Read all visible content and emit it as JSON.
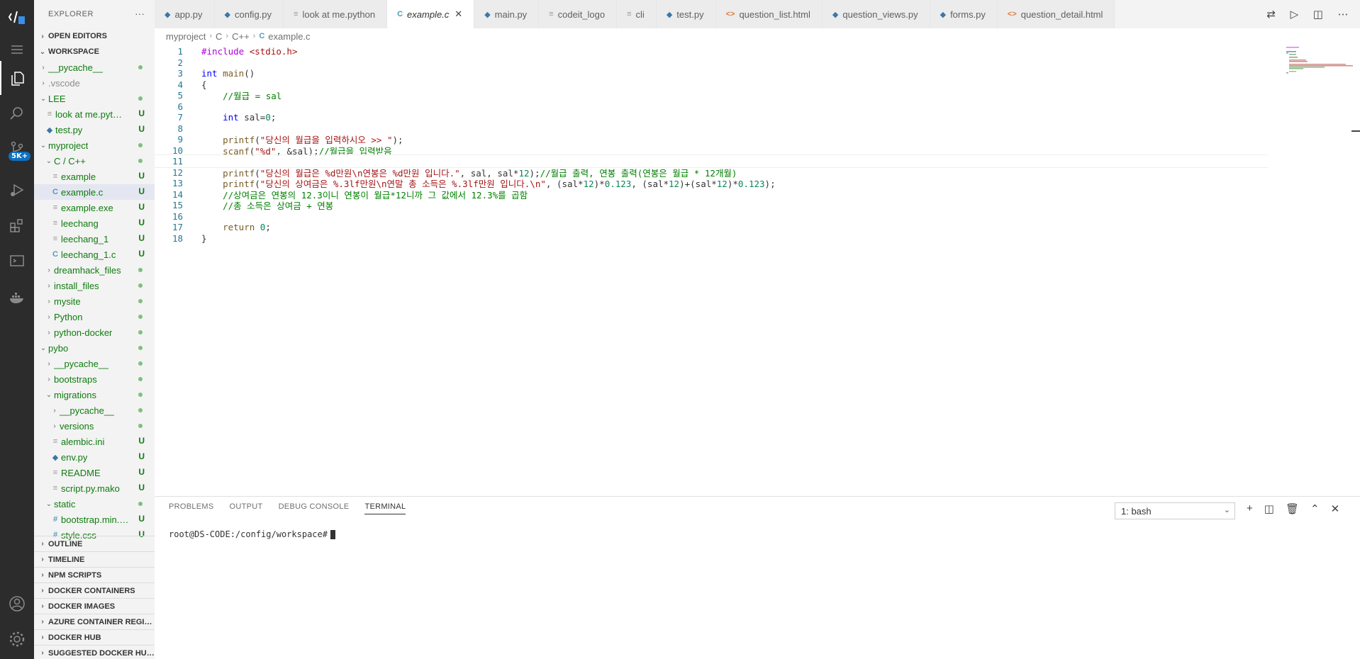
{
  "explorer": {
    "title": "EXPLORER",
    "more": "···",
    "open_editors": "OPEN EDITORS",
    "workspace": "WORKSPACE",
    "tree": [
      {
        "name": "__pycache__",
        "kind": "folder",
        "depth": 1,
        "open": false,
        "status": "dot"
      },
      {
        "name": ".vscode",
        "kind": "folder",
        "depth": 1,
        "open": false,
        "status": "",
        "muted": true
      },
      {
        "name": "LEE",
        "kind": "folder",
        "depth": 1,
        "open": true,
        "status": "dot"
      },
      {
        "name": "look at me.python",
        "kind": "lines",
        "depth": 2,
        "status": "U"
      },
      {
        "name": "test.py",
        "kind": "py",
        "depth": 2,
        "status": "U"
      },
      {
        "name": "myproject",
        "kind": "folder",
        "depth": 1,
        "open": true,
        "status": "dot"
      },
      {
        "name": "C / C++",
        "kind": "folder",
        "depth": 2,
        "open": true,
        "status": "dot"
      },
      {
        "name": "example",
        "kind": "lines",
        "depth": 3,
        "status": "U"
      },
      {
        "name": "example.c",
        "kind": "c",
        "depth": 3,
        "status": "U",
        "selected": true
      },
      {
        "name": "example.exe",
        "kind": "lines",
        "depth": 3,
        "status": "U"
      },
      {
        "name": "leechang",
        "kind": "lines",
        "depth": 3,
        "status": "U"
      },
      {
        "name": "leechang_1",
        "kind": "lines",
        "depth": 3,
        "status": "U"
      },
      {
        "name": "leechang_1.c",
        "kind": "c",
        "depth": 3,
        "status": "U"
      },
      {
        "name": "dreamhack_files",
        "kind": "folder",
        "depth": 2,
        "open": false,
        "status": "dot"
      },
      {
        "name": "install_files",
        "kind": "folder",
        "depth": 2,
        "open": false,
        "status": "dot"
      },
      {
        "name": "mysite",
        "kind": "folder",
        "depth": 2,
        "open": false,
        "status": "dot"
      },
      {
        "name": "Python",
        "kind": "folder",
        "depth": 2,
        "open": false,
        "status": "dot"
      },
      {
        "name": "python-docker",
        "kind": "folder",
        "depth": 2,
        "open": false,
        "status": "dot"
      },
      {
        "name": "pybo",
        "kind": "folder",
        "depth": 1,
        "open": true,
        "status": "dot"
      },
      {
        "name": "__pycache__",
        "kind": "folder",
        "depth": 2,
        "open": false,
        "status": "dot"
      },
      {
        "name": "bootstraps",
        "kind": "folder",
        "depth": 2,
        "open": false,
        "status": "dot"
      },
      {
        "name": "migrations",
        "kind": "folder",
        "depth": 2,
        "open": true,
        "status": "dot"
      },
      {
        "name": "__pycache__",
        "kind": "folder",
        "depth": 3,
        "open": false,
        "status": "dot"
      },
      {
        "name": "versions",
        "kind": "folder",
        "depth": 3,
        "open": false,
        "status": "dot"
      },
      {
        "name": "alembic.ini",
        "kind": "lines",
        "depth": 3,
        "status": "U"
      },
      {
        "name": "env.py",
        "kind": "py",
        "depth": 3,
        "status": "U"
      },
      {
        "name": "README",
        "kind": "lines",
        "depth": 3,
        "status": "U"
      },
      {
        "name": "script.py.mako",
        "kind": "lines",
        "depth": 3,
        "status": "U"
      },
      {
        "name": "static",
        "kind": "folder",
        "depth": 2,
        "open": true,
        "status": "dot"
      },
      {
        "name": "bootstrap.min.css",
        "kind": "hash",
        "depth": 3,
        "status": "U"
      },
      {
        "name": "style.css",
        "kind": "hash",
        "depth": 3,
        "status": "U"
      }
    ],
    "bottom_sections": [
      "OUTLINE",
      "TIMELINE",
      "NPM SCRIPTS",
      "DOCKER CONTAINERS",
      "DOCKER IMAGES",
      "AZURE CONTAINER REGISTRY",
      "DOCKER HUB",
      "SUGGESTED DOCKER HUB IMAGES"
    ]
  },
  "activity": {
    "badge": "5K+"
  },
  "tabs": [
    {
      "label": "app.py",
      "icon": "py"
    },
    {
      "label": "config.py",
      "icon": "py"
    },
    {
      "label": "look at me.python",
      "icon": "lines"
    },
    {
      "label": "example.c",
      "icon": "c",
      "active": true
    },
    {
      "label": "main.py",
      "icon": "py"
    },
    {
      "label": "codeit_logo",
      "icon": "lines"
    },
    {
      "label": "cli",
      "icon": "lines"
    },
    {
      "label": "test.py",
      "icon": "py"
    },
    {
      "label": "question_list.html",
      "icon": "html"
    },
    {
      "label": "question_views.py",
      "icon": "py"
    },
    {
      "label": "forms.py",
      "icon": "py"
    },
    {
      "label": "question_detail.html",
      "icon": "html"
    }
  ],
  "breadcrumb": [
    "myproject",
    "C",
    "C++",
    "example.c"
  ],
  "editor": {
    "current_line": 11,
    "lines": [
      [
        [
          "pp",
          "#include "
        ],
        [
          "str",
          "<stdio.h>"
        ]
      ],
      [],
      [
        [
          "kw",
          "int "
        ],
        [
          "fn",
          "main"
        ],
        [
          "",
          "()"
        ]
      ],
      [
        [
          "",
          "{"
        ]
      ],
      [
        [
          "",
          "    "
        ],
        [
          "cm",
          "//월급 = sal"
        ]
      ],
      [],
      [
        [
          "",
          "    "
        ],
        [
          "kw",
          "int "
        ],
        [
          "",
          "sal="
        ],
        [
          "num",
          "0"
        ],
        [
          "",
          ";"
        ]
      ],
      [],
      [
        [
          "",
          "    "
        ],
        [
          "fn",
          "printf"
        ],
        [
          "",
          "("
        ],
        [
          "str",
          "\"당신의 월급을 입력하시오 >> \""
        ],
        [
          "",
          ");"
        ]
      ],
      [
        [
          "",
          "    "
        ],
        [
          "fn",
          "scanf"
        ],
        [
          "",
          "("
        ],
        [
          "str",
          "\"%d\""
        ],
        [
          "",
          ", &sal);"
        ],
        [
          "cm",
          "//월급을 입력받음"
        ]
      ],
      [],
      [
        [
          "",
          "    "
        ],
        [
          "fn",
          "printf"
        ],
        [
          "",
          "("
        ],
        [
          "str",
          "\"당신의 월급은 %d만원\\n연봉은 %d만원 입니다.\""
        ],
        [
          "",
          ", sal, sal*"
        ],
        [
          "num",
          "12"
        ],
        [
          "",
          ");"
        ],
        [
          "cm",
          "//월급 출력, 연봉 출력(연봉은 월급 * 12개월)"
        ]
      ],
      [
        [
          "",
          "    "
        ],
        [
          "fn",
          "printf"
        ],
        [
          "",
          "("
        ],
        [
          "str",
          "\"당신의 상여금은 %.3lf만원\\n연말 총 소득은 %.3lf만원 입니다.\\n\""
        ],
        [
          "",
          ", (sal*"
        ],
        [
          "num",
          "12"
        ],
        [
          "",
          ")*"
        ],
        [
          "num",
          "0.123"
        ],
        [
          "",
          ", (sal*"
        ],
        [
          "num",
          "12"
        ],
        [
          "",
          ")+(sal*"
        ],
        [
          "num",
          "12"
        ],
        [
          "",
          ")*"
        ],
        [
          "num",
          "0.123"
        ],
        [
          "",
          ");"
        ]
      ],
      [
        [
          "",
          "    "
        ],
        [
          "cm",
          "//상여금은 연봉의 12.3이니 연봉이 월급*12니까 그 값에서 12.3%를 곱함"
        ]
      ],
      [
        [
          "",
          "    "
        ],
        [
          "cm",
          "//총 소득은 상여금 + 연봉"
        ]
      ],
      [],
      [
        [
          "",
          "    "
        ],
        [
          "fn",
          "return "
        ],
        [
          "num",
          "0"
        ],
        [
          "",
          ";"
        ]
      ],
      [
        [
          "",
          "}"
        ]
      ]
    ]
  },
  "panel": {
    "tabs": [
      "PROBLEMS",
      "OUTPUT",
      "DEBUG CONSOLE",
      "TERMINAL"
    ],
    "active_tab": "TERMINAL",
    "terminal_select": "1: bash",
    "prompt": "root@DS-CODE:/config/workspace#"
  }
}
